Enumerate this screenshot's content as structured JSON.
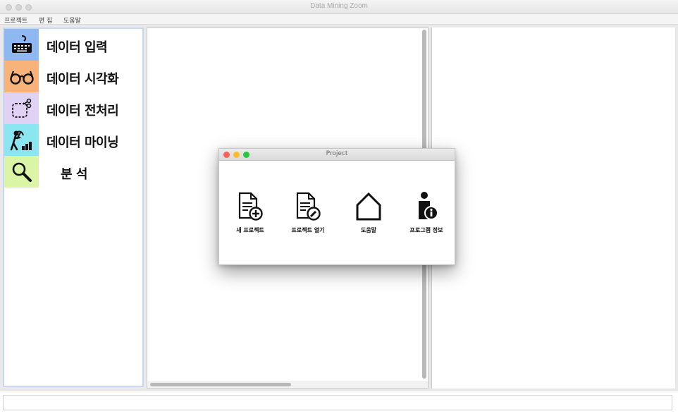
{
  "window": {
    "title": "Data Mining Zoom"
  },
  "menubar": {
    "items": [
      "프로젝트",
      "편 집",
      "도움말"
    ]
  },
  "sidebar": {
    "items": [
      {
        "label": "데이터 입력",
        "icon": "keyboard-icon",
        "color": "#8fb8f0"
      },
      {
        "label": "데이터 시각화",
        "icon": "glasses-icon",
        "color": "#f7b37a"
      },
      {
        "label": "데이터 전처리",
        "icon": "scissors-cut-icon",
        "color": "#e0d2f4"
      },
      {
        "label": "데이터 마이닝",
        "icon": "miner-icon",
        "color": "#8ce6f2"
      },
      {
        "label": "분   석",
        "icon": "magnifier-icon",
        "color": "#dbf5a6"
      }
    ]
  },
  "dialog": {
    "title": "Project",
    "buttons": [
      {
        "label": "새 프로젝트",
        "icon": "new-project-icon"
      },
      {
        "label": "프로젝트 열기",
        "icon": "open-project-icon"
      },
      {
        "label": "도움말",
        "icon": "home-icon"
      },
      {
        "label": "프로그램 정보",
        "icon": "info-icon"
      }
    ]
  },
  "colors": {
    "dot_red": "#fc5f57",
    "dot_yellow": "#fdbc2e",
    "dot_green": "#29c840"
  }
}
